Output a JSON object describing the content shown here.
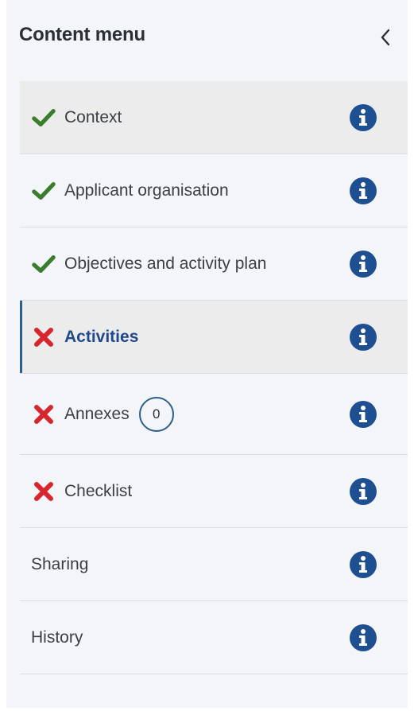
{
  "header": {
    "title": "Content menu",
    "collapse_icon": "chevron-left-icon"
  },
  "colors": {
    "complete": "#3b7d2e",
    "incomplete": "#d8262f",
    "info": "#1d4f91",
    "active_accent": "#2c5f8c"
  },
  "menu": {
    "items": [
      {
        "label": "Context",
        "status": "complete",
        "info_icon": "info-icon"
      },
      {
        "label": "Applicant organisation",
        "status": "complete",
        "info_icon": "info-icon"
      },
      {
        "label": "Objectives and activity plan",
        "status": "complete",
        "info_icon": "info-icon"
      },
      {
        "label": "Activities",
        "status": "incomplete",
        "active": true,
        "info_icon": "info-icon"
      },
      {
        "label": "Annexes",
        "status": "incomplete",
        "badge": "0",
        "info_icon": "info-icon"
      },
      {
        "label": "Checklist",
        "status": "incomplete",
        "info_icon": "info-icon"
      },
      {
        "label": "Sharing",
        "status": "none",
        "info_icon": "info-icon"
      },
      {
        "label": "History",
        "status": "none",
        "info_icon": "info-icon"
      }
    ]
  }
}
